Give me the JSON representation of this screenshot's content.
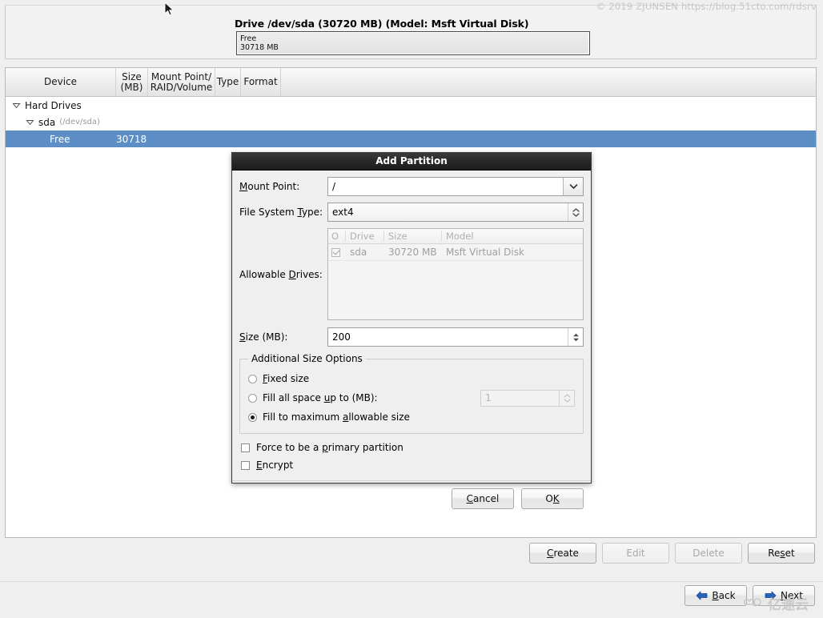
{
  "drive": {
    "title": "Drive /dev/sda (30720 MB) (Model: Msft Virtual Disk)",
    "segment_label": "Free",
    "segment_size": "30718 MB"
  },
  "table": {
    "headers": {
      "device": "Device",
      "size_line1": "Size",
      "size_line2": "(MB)",
      "mount_line1": "Mount Point/",
      "mount_line2": "RAID/Volume",
      "type": "Type",
      "format": "Format"
    },
    "rows": [
      {
        "label": "Hard Drives",
        "detail": "",
        "size": "",
        "indent": 0,
        "twisty": true,
        "selected": false
      },
      {
        "label": "sda",
        "detail": "(/dev/sda)",
        "size": "",
        "indent": 1,
        "twisty": true,
        "selected": false
      },
      {
        "label": "Free",
        "detail": "",
        "size": "30718",
        "indent": 2,
        "twisty": false,
        "selected": true
      }
    ]
  },
  "actions": {
    "create": "Create",
    "create_mnemonic": "C",
    "edit": "Edit",
    "delete": "Delete",
    "reset": "Reset",
    "back": "Back",
    "next": "Next",
    "edit_enabled": false,
    "delete_enabled": false
  },
  "dialog": {
    "title": "Add Partition",
    "mount_point": {
      "label_pre": "",
      "label_mnemonic": "M",
      "label_post": "ount Point:",
      "value": "/",
      "icon": "chevron-down-icon"
    },
    "file_system_type": {
      "label_pre": "File System ",
      "label_mnemonic": "T",
      "label_post": "ype:",
      "value": "ext4",
      "icon": "chevron-updown-icon"
    },
    "allowable_drives": {
      "label_pre": "Allowable ",
      "label_mnemonic": "D",
      "label_post": "rives:",
      "columns": [
        "O",
        "Drive",
        "Size",
        "Model"
      ],
      "rows": [
        {
          "checked": true,
          "drive": "sda",
          "size": "30720 MB",
          "model": "Msft Virtual Disk"
        }
      ]
    },
    "size": {
      "label_pre": "",
      "label_mnemonic": "S",
      "label_post": "ize (MB):",
      "value": "200"
    },
    "additional_size_options": {
      "legend": "Additional Size Options",
      "options": [
        {
          "label_pre": "",
          "mnemonic": "F",
          "label_post": "ixed size",
          "selected": false,
          "has_field": false
        },
        {
          "label_pre": "Fill all space ",
          "mnemonic": "u",
          "label_post": "p to (MB):",
          "selected": false,
          "has_field": true,
          "field_value": "1",
          "field_enabled": false
        },
        {
          "label_pre": "Fill to maximum ",
          "mnemonic": "a",
          "label_post": "llowable size",
          "selected": true,
          "has_field": false
        }
      ]
    },
    "checkboxes": [
      {
        "label_pre": "Force to be a ",
        "mnemonic": "p",
        "label_post": "rimary partition",
        "checked": false
      },
      {
        "label_pre": "",
        "mnemonic": "E",
        "label_post": "ncrypt",
        "checked": false
      }
    ],
    "buttons": {
      "cancel": "Cancel",
      "cancel_mnemonic": "C",
      "ok_pre": "O",
      "ok_mnemonic": "K"
    }
  },
  "watermarks": {
    "top_right": "© 2019 ZJUNSEN https://blog.51cto.com/rdsrv",
    "bottom_right": "亿速云"
  },
  "colors": {
    "selection_blue": "#5d8fc6",
    "titlebar_dark": "#262626",
    "arrow_blue": "#2b62b5",
    "panel_bg": "#efefef"
  }
}
